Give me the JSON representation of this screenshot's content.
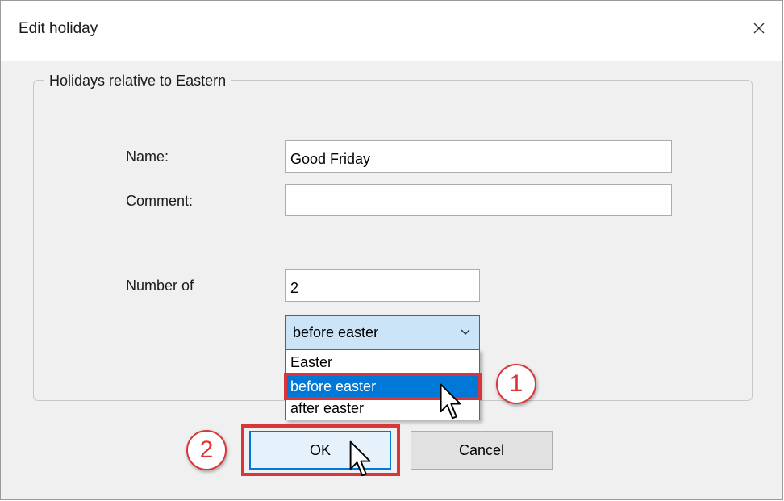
{
  "window": {
    "title": "Edit holiday",
    "close_icon": "close-icon"
  },
  "group": {
    "legend": "Holidays relative to Eastern"
  },
  "fields": {
    "name_label": "Name:",
    "name_value": "Good Friday",
    "comment_label": "Comment:",
    "comment_value": "",
    "number_label": "Number of",
    "number_value": "2"
  },
  "combo": {
    "selected": "before easter",
    "options": [
      "Easter",
      "before easter",
      "after easter"
    ],
    "highlighted_index": 1
  },
  "buttons": {
    "ok_label": "OK",
    "cancel_label": "Cancel"
  },
  "annotations": {
    "marker_1": "1",
    "marker_2": "2",
    "color": "#d9363a"
  },
  "colors": {
    "accent": "#0078d7",
    "combo_background": "#cce4f7",
    "dialog_background": "#f0f0f0"
  }
}
